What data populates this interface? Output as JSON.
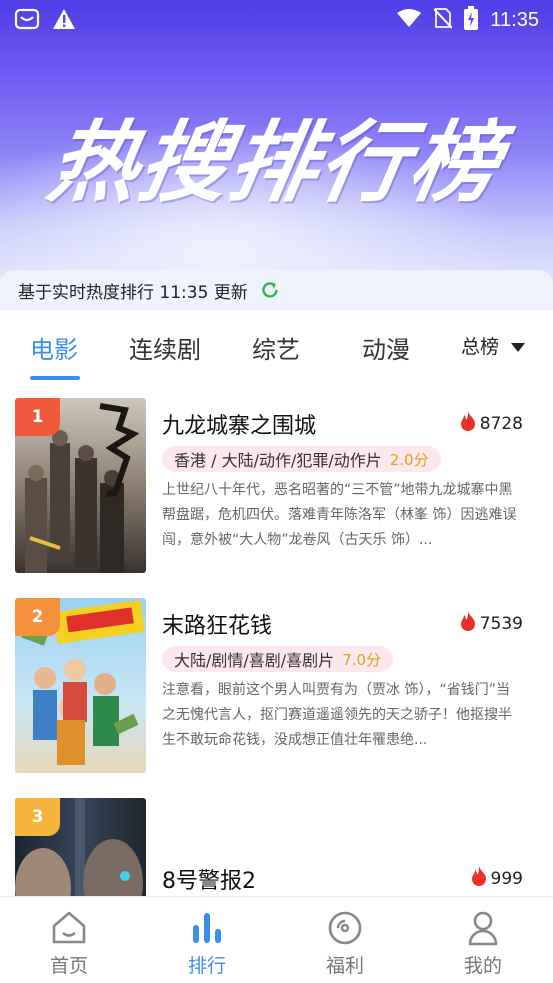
{
  "status_bar": {
    "time": "11:35"
  },
  "hero": {
    "title": "热搜排行榜"
  },
  "update_bar": {
    "text": "基于实时热度排行 11:35 更新"
  },
  "tabs": [
    {
      "label": "电影",
      "active": true
    },
    {
      "label": "连续剧",
      "active": false
    },
    {
      "label": "综艺",
      "active": false
    },
    {
      "label": "动漫",
      "active": false
    }
  ],
  "rank_select": {
    "label": "总榜"
  },
  "movies": [
    {
      "rank": "1",
      "title": "九龙城寨之围城",
      "heat": "8728",
      "tags": "香港 / 大陆/动作/犯罪/动作片",
      "score": "2.0分",
      "description": "上世纪八十年代，恶名昭著的“三不管”地带九龙城寨中黑帮盘踞，危机四伏。落难青年陈洛军（林峯 饰）因逃难误闯，意外被“大人物”龙卷风（古天乐 饰）..."
    },
    {
      "rank": "2",
      "title": "末路狂花钱",
      "heat": "7539",
      "tags": "大陆/剧情/喜剧/喜剧片",
      "score": "7.0分",
      "description": "注意看，眼前这个男人叫贾有为（贾冰 饰），“省钱门”当之无愧代言人，抠门赛道遥遥领先的天之骄子！他抠搜半生不敢玩命花钱，没成想正值壮年罹患绝..."
    },
    {
      "rank": "3",
      "title": "8号警报2",
      "heat": "999",
      "tags": "",
      "score": "",
      "description": ""
    }
  ],
  "bottom_nav": [
    {
      "label": "首页",
      "icon": "home-icon",
      "active": false
    },
    {
      "label": "排行",
      "icon": "ranking-icon",
      "active": true
    },
    {
      "label": "福利",
      "icon": "welfare-icon",
      "active": false
    },
    {
      "label": "我的",
      "icon": "profile-icon",
      "active": false
    }
  ],
  "colors": {
    "accent": "#3a8ef0",
    "heat_flame": "#e8302c",
    "tag_bg": "#fde8ee",
    "score": "#e0a020",
    "rank1": "#f0593c",
    "rank2": "#f5903c",
    "rank3": "#f5b43c"
  }
}
